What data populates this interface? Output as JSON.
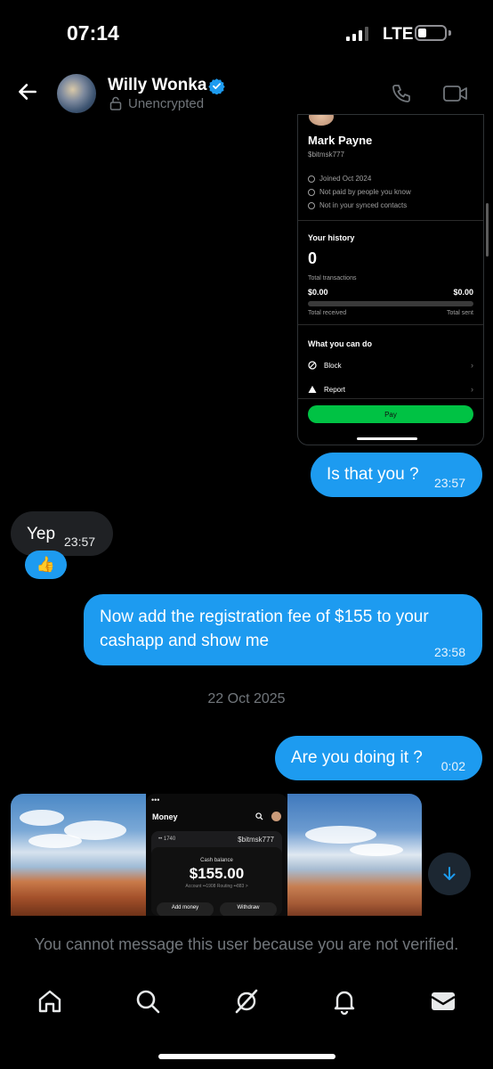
{
  "status_bar": {
    "time": "07:14",
    "network": "LTE"
  },
  "header": {
    "name": "Willy Wonka",
    "encryption": "Unencrypted",
    "icons": [
      "back-arrow-icon",
      "verified-badge-icon",
      "lock-open-icon",
      "phone-icon",
      "video-icon"
    ]
  },
  "shared_card": {
    "name": "Mark Payne",
    "cashtag": "$bitmsk777",
    "meta": [
      "Joined Oct 2024",
      "Not paid by people you know",
      "Not in your synced contacts"
    ],
    "history_title": "Your history",
    "transactions_count": "0",
    "transactions_label": "Total transactions",
    "received_amount": "$0.00",
    "sent_amount": "$0.00",
    "received_label": "Total received",
    "sent_label": "Total sent",
    "actions_title": "What you can do",
    "block_label": "Block",
    "report_label": "Report",
    "pay_label": "Pay"
  },
  "messages": [
    {
      "direction": "out",
      "text": "Is that you ?",
      "time": "23:57"
    },
    {
      "direction": "in",
      "text": "Yep",
      "time": "23:57",
      "reaction": "👍"
    },
    {
      "direction": "out",
      "text": "Now add  the registration fee of $155 to your cashapp and show me",
      "time": "23:58"
    },
    {
      "direction": "out",
      "text": "Are you doing it ?",
      "time": "0:02"
    }
  ],
  "date_separator": "22 Oct 2025",
  "media_preview": {
    "title": "Money",
    "account_chip": "•• 1740",
    "cashtag": "$bitmsk777",
    "balance_label": "Cash balance",
    "balance": "$155.00",
    "account_detail": "Account ••1908  Routing ••883  >",
    "add_money": "Add money",
    "withdraw": "Withdraw"
  },
  "notice": "You cannot message this user because you are not verified.",
  "colors": {
    "accent": "#1d9bf0",
    "incoming_bubble": "#1f2124",
    "muted": "#71767b",
    "pay_green": "#00c244"
  },
  "bottom_nav": [
    "home-icon",
    "search-icon",
    "grok-icon",
    "notifications-icon",
    "messages-icon"
  ]
}
